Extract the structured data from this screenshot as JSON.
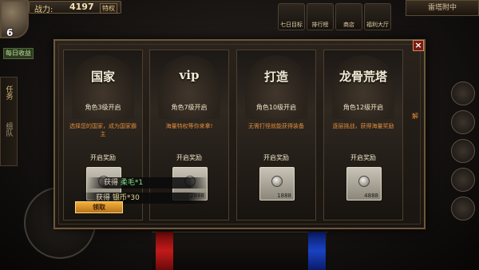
{
  "hud": {
    "level": "6",
    "power_label": "战力:",
    "power_value": "4197",
    "power_tag": "特权",
    "daily_label": "每日收益",
    "top_icons": [
      {
        "label": "七日目标",
        "icon": "calendar-icon"
      },
      {
        "label": "排行榜",
        "icon": "ranking-icon"
      },
      {
        "label": "商店",
        "icon": "shop-icon"
      },
      {
        "label": "福利大厅",
        "icon": "gift-icon"
      }
    ],
    "right_title": "雷塔附中",
    "side_tabs": [
      "任务",
      "组队"
    ]
  },
  "modal": {
    "cards": [
      {
        "title": "国家",
        "unlock": "角色3级开启",
        "desc": "选择您的国家，成为国家霸主",
        "reward_label": "开启奖励",
        "reward_count": ""
      },
      {
        "title": "vip",
        "unlock": "角色7级开启",
        "desc": "海量特权等你来拿!",
        "reward_label": "开启奖励",
        "reward_count": "2888"
      },
      {
        "title": "打造",
        "unlock": "角色10级开启",
        "desc": "无需打怪就能获得装备",
        "reward_label": "开启奖励",
        "reward_count": "1888"
      },
      {
        "title": "龙骨荒塔",
        "unlock": "角色12级开启",
        "desc": "逐层挑战，获得海量奖励",
        "reward_label": "开启奖励",
        "reward_count": "4888"
      }
    ],
    "edge_text": "解",
    "close_glyph": "×"
  },
  "toasts": {
    "first_prefix": "获得",
    "first_item": "柔毛*1",
    "second_prefix": "获得",
    "second_item": "银币*30"
  },
  "claim_button": "领取"
}
